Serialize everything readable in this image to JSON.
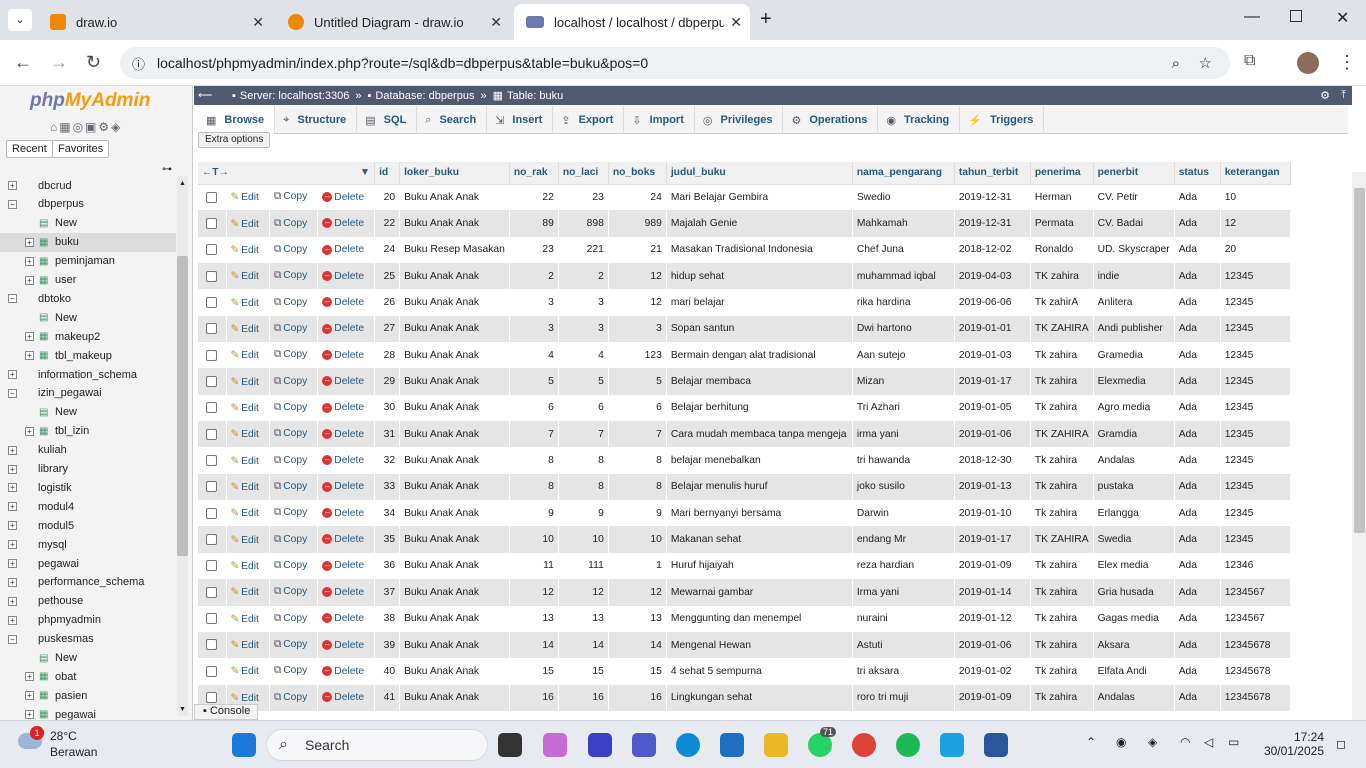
{
  "browser": {
    "tabs": [
      {
        "title": "draw.io",
        "color": "#f08705"
      },
      {
        "title": "Untitled Diagram - draw.io",
        "color": "#f08705"
      },
      {
        "title": "localhost / localhost / dbperpus",
        "color": "#6c78af"
      }
    ],
    "new_tab": "+",
    "url": "localhost/phpmyadmin/index.php?route=/sql&db=dbperpus&table=buku&pos=0"
  },
  "sidebar": {
    "logo_php": "php",
    "logo_my": "MyAdmin",
    "tab_recent": "Recent",
    "tab_favorites": "Favorites",
    "tree": [
      {
        "label": "dbcrud",
        "level": 0
      },
      {
        "label": "dbperpus",
        "level": 0
      },
      {
        "label": "New",
        "level": 1
      },
      {
        "label": "buku",
        "level": 1,
        "selected": true
      },
      {
        "label": "peminjaman",
        "level": 1
      },
      {
        "label": "user",
        "level": 1
      },
      {
        "label": "dbtoko",
        "level": 0
      },
      {
        "label": "New",
        "level": 1
      },
      {
        "label": "makeup2",
        "level": 1
      },
      {
        "label": "tbl_makeup",
        "level": 1
      },
      {
        "label": "information_schema",
        "level": 0
      },
      {
        "label": "izin_pegawai",
        "level": 0
      },
      {
        "label": "New",
        "level": 1
      },
      {
        "label": "tbl_izin",
        "level": 1
      },
      {
        "label": "kuliah",
        "level": 0
      },
      {
        "label": "library",
        "level": 0
      },
      {
        "label": "logistik",
        "level": 0
      },
      {
        "label": "modul4",
        "level": 0
      },
      {
        "label": "modul5",
        "level": 0
      },
      {
        "label": "mysql",
        "level": 0
      },
      {
        "label": "pegawai",
        "level": 0
      },
      {
        "label": "performance_schema",
        "level": 0
      },
      {
        "label": "pethouse",
        "level": 0
      },
      {
        "label": "phpmyadmin",
        "level": 0
      },
      {
        "label": "puskesmas",
        "level": 0
      },
      {
        "label": "New",
        "level": 1
      },
      {
        "label": "obat",
        "level": 1
      },
      {
        "label": "pasien",
        "level": 1
      },
      {
        "label": "pegawai",
        "level": 1
      }
    ]
  },
  "breadcrumb": {
    "server": "Server: localhost:3306",
    "database": "Database: dbperpus",
    "table": "Table: buku",
    "sep": "»"
  },
  "main_tabs": [
    "Browse",
    "Structure",
    "SQL",
    "Search",
    "Insert",
    "Export",
    "Import",
    "Privileges",
    "Operations",
    "Tracking",
    "Triggers"
  ],
  "extra_options": "Extra options",
  "row_actions": {
    "edit": "Edit",
    "copy": "Copy",
    "delete": "Delete"
  },
  "table": {
    "columns": [
      "id",
      "loker_buku",
      "no_rak",
      "no_laci",
      "no_boks",
      "judul_buku",
      "nama_pengarang",
      "tahun_terbit",
      "penerima",
      "penerbit",
      "status",
      "keterangan"
    ],
    "rows": [
      [
        "20",
        "Buku Anak Anak",
        "22",
        "23",
        "24",
        "Mari Belajar Gembira",
        "Swedio",
        "2019-12-31",
        "Herman",
        "CV. Petir",
        "Ada",
        "10"
      ],
      [
        "22",
        "Buku Anak Anak",
        "89",
        "898",
        "989",
        "Majalah Genie",
        "Mahkamah",
        "2019-12-31",
        "Permata",
        "CV. Badai",
        "Ada",
        "12"
      ],
      [
        "24",
        "Buku Resep Masakan",
        "23",
        "221",
        "21",
        "Masakan Tradisional Indonesia",
        "Chef Juna",
        "2018-12-02",
        "Ronaldo",
        "UD. Skyscraper",
        "Ada",
        "20"
      ],
      [
        "25",
        "Buku Anak Anak",
        "2",
        "2",
        "12",
        "hidup sehat",
        "muhammad iqbal",
        "2019-04-03",
        "TK zahira",
        "indie",
        "Ada",
        "12345"
      ],
      [
        "26",
        "Buku Anak Anak",
        "3",
        "3",
        "12",
        "mari belajar",
        "rika hardina",
        "2019-06-06",
        "Tk zahirA",
        "Anlitera",
        "Ada",
        "12345"
      ],
      [
        "27",
        "Buku Anak Anak",
        "3",
        "3",
        "3",
        "Sopan santun",
        "Dwi hartono",
        "2019-01-01",
        "TK ZAHIRA",
        "Andi publisher",
        "Ada",
        "12345"
      ],
      [
        "28",
        "Buku Anak Anak",
        "4",
        "4",
        "123",
        "Bermain dengan alat tradisional",
        "Aan sutejo",
        "2019-01-03",
        "Tk zahira",
        "Gramedia",
        "Ada",
        "12345"
      ],
      [
        "29",
        "Buku Anak Anak",
        "5",
        "5",
        "5",
        "Belajar membaca",
        "Mizan",
        "2019-01-17",
        "Tk zahira",
        "Elexmedia",
        "Ada",
        "12345"
      ],
      [
        "30",
        "Buku Anak Anak",
        "6",
        "6",
        "6",
        "Belajar berhitung",
        "Tri Azhari",
        "2019-01-05",
        "Tk zahira",
        "Agro media",
        "Ada",
        "12345"
      ],
      [
        "31",
        "Buku Anak Anak",
        "7",
        "7",
        "7",
        "Cara mudah membaca tanpa mengeja",
        "irma yani",
        "2019-01-06",
        "TK ZAHIRA",
        "Gramdia",
        "Ada",
        "12345"
      ],
      [
        "32",
        "Buku Anak Anak",
        "8",
        "8",
        "8",
        "belajar menebalkan",
        "tri hawanda",
        "2018-12-30",
        "Tk zahira",
        "Andalas",
        "Ada",
        "12345"
      ],
      [
        "33",
        "Buku Anak Anak",
        "8",
        "8",
        "8",
        "Belajar menulis huruf",
        "joko susilo",
        "2019-01-13",
        "Tk zahira",
        "pustaka",
        "Ada",
        "12345"
      ],
      [
        "34",
        "Buku Anak Anak",
        "9",
        "9",
        "9",
        "Mari bernyanyi bersama",
        "Darwin",
        "2019-01-10",
        "Tk zahira",
        "Erlangga",
        "Ada",
        "12345"
      ],
      [
        "35",
        "Buku Anak Anak",
        "10",
        "10",
        "10",
        "Makanan sehat",
        "endang Mr",
        "2019-01-17",
        "TK ZAHIRA",
        "Swedia",
        "Ada",
        "12345"
      ],
      [
        "36",
        "Buku Anak Anak",
        "11",
        "111",
        "1",
        "Huruf hijaiyah",
        "reza hardian",
        "2019-01-09",
        "Tk zahira",
        "Elex media",
        "Ada",
        "12346"
      ],
      [
        "37",
        "Buku Anak Anak",
        "12",
        "12",
        "12",
        "Mewarnai gambar",
        "Irma yani",
        "2019-01-14",
        "Tk zahira",
        "Gria husada",
        "Ada",
        "1234567"
      ],
      [
        "38",
        "Buku Anak Anak",
        "13",
        "13",
        "13",
        "Menggunting dan menempel",
        "nuraini",
        "2019-01-12",
        "Tk zahira",
        "Gagas media",
        "Ada",
        "1234567"
      ],
      [
        "39",
        "Buku Anak Anak",
        "14",
        "14",
        "14",
        "Mengenal Hewan",
        "Astuti",
        "2019-01-06",
        "Tk zahira",
        "Aksara",
        "Ada",
        "12345678"
      ],
      [
        "40",
        "Buku Anak Anak",
        "15",
        "15",
        "15",
        "4 sehat 5 sempurna",
        "tri aksara",
        "2019-01-02",
        "Tk zahira",
        "Elfata Andi",
        "Ada",
        "12345678"
      ],
      [
        "41",
        "Buku Anak Anak",
        "16",
        "16",
        "16",
        "Lingkungan sehat",
        "roro tri muji",
        "2019-01-09",
        "Tk zahira",
        "Andalas",
        "Ada",
        "12345678"
      ]
    ]
  },
  "console": "Console",
  "taskbar": {
    "temp": "28°C",
    "weather": "Berawan",
    "search": "Search",
    "time": "17:24",
    "date": "30/01/2025",
    "badge_weather": "1",
    "badge_whatsapp": "71"
  }
}
